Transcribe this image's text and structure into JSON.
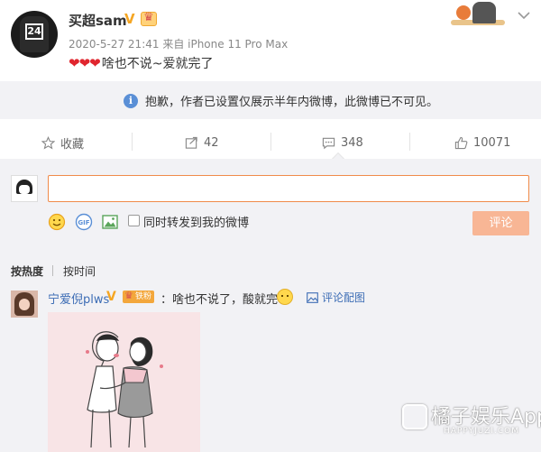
{
  "post": {
    "username": "买超sam",
    "vip_mark": "V",
    "meta": "2020-5-27 21:41 来自 iPhone 11 Pro Max",
    "hearts": "❤❤❤",
    "text": "啥也不说~爱就完了",
    "avatar_number": "24"
  },
  "notice": {
    "icon_letter": "i",
    "text": "抱歉，作者已设置仅展示半年内微博，此微博已不可见。"
  },
  "actions": {
    "favorite": "收藏",
    "repost": "42",
    "comment": "348",
    "like": "10071"
  },
  "composer": {
    "input_value": "",
    "repost_label": "同时转发到我的微博",
    "submit": "评论"
  },
  "sort": {
    "hot": "按热度",
    "time": "按时间"
  },
  "comment": {
    "user": "宁爱倪plws",
    "vip_mark": "V",
    "fan_badge": "铁粉",
    "text": "：啥也不说了，酸就完了",
    "image_link": "评论配图"
  },
  "watermark": {
    "title": "橘子娱乐App",
    "subtitle": "HAPPYJUZI.COM"
  },
  "colors": {
    "link_blue": "#3d6db5",
    "accent_orange": "#f08b4a",
    "heart_red": "#e0252e",
    "panel_bg": "#f2f2f5"
  }
}
